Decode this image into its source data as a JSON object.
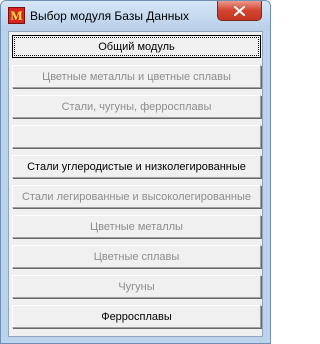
{
  "window": {
    "title": "Выбор модуля Базы Данных",
    "app_icon_letter": "M",
    "close_icon": "close-icon"
  },
  "buttons": [
    {
      "label": "Общий модуль",
      "enabled": true,
      "focused": true
    },
    {
      "label": "Цветные металлы и цветные сплавы",
      "enabled": false
    },
    {
      "label": "Стали, чугуны, ферросплавы",
      "enabled": false
    },
    {
      "label": "",
      "enabled": false
    },
    {
      "label": "Стали углеродистые и низколегированные",
      "enabled": true
    },
    {
      "label": "Стали легированные и высоколегированные",
      "enabled": false
    },
    {
      "label": "Цветные металлы",
      "enabled": false
    },
    {
      "label": "Цветные  сплавы",
      "enabled": false
    },
    {
      "label": "Чугуны",
      "enabled": false
    },
    {
      "label": "Ферросплавы",
      "enabled": true
    }
  ],
  "colors": {
    "frame": "#bcd3ec",
    "close_button": "#d2442f",
    "disabled_text": "#8d8d8d"
  }
}
